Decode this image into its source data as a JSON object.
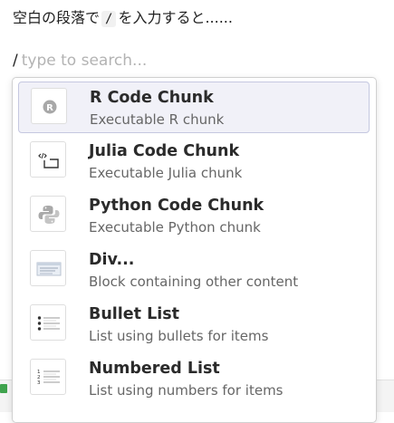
{
  "instruction": {
    "before": "空白の段落で",
    "code": "/",
    "after": "を入力すると......"
  },
  "input": {
    "slash": "/",
    "placeholder": "type to search..."
  },
  "menu": {
    "items": [
      {
        "title": "R Code Chunk",
        "description": "Executable R chunk",
        "icon": "r-logo-icon",
        "selected": true
      },
      {
        "title": "Julia Code Chunk",
        "description": "Executable Julia chunk",
        "icon": "code-chunk-icon",
        "selected": false
      },
      {
        "title": "Python Code Chunk",
        "description": "Executable Python chunk",
        "icon": "python-logo-icon",
        "selected": false
      },
      {
        "title": "Div...",
        "description": "Block containing other content",
        "icon": "div-block-icon",
        "selected": false
      },
      {
        "title": "Bullet List",
        "description": "List using bullets for items",
        "icon": "bullet-list-icon",
        "selected": false
      },
      {
        "title": "Numbered List",
        "description": "List using numbers for items",
        "icon": "numbered-list-icon",
        "selected": false
      }
    ]
  },
  "colors": {
    "selected_background": "#f1f1f8",
    "selected_border": "#c5c8e0",
    "status_badge": "#3fa34d"
  }
}
